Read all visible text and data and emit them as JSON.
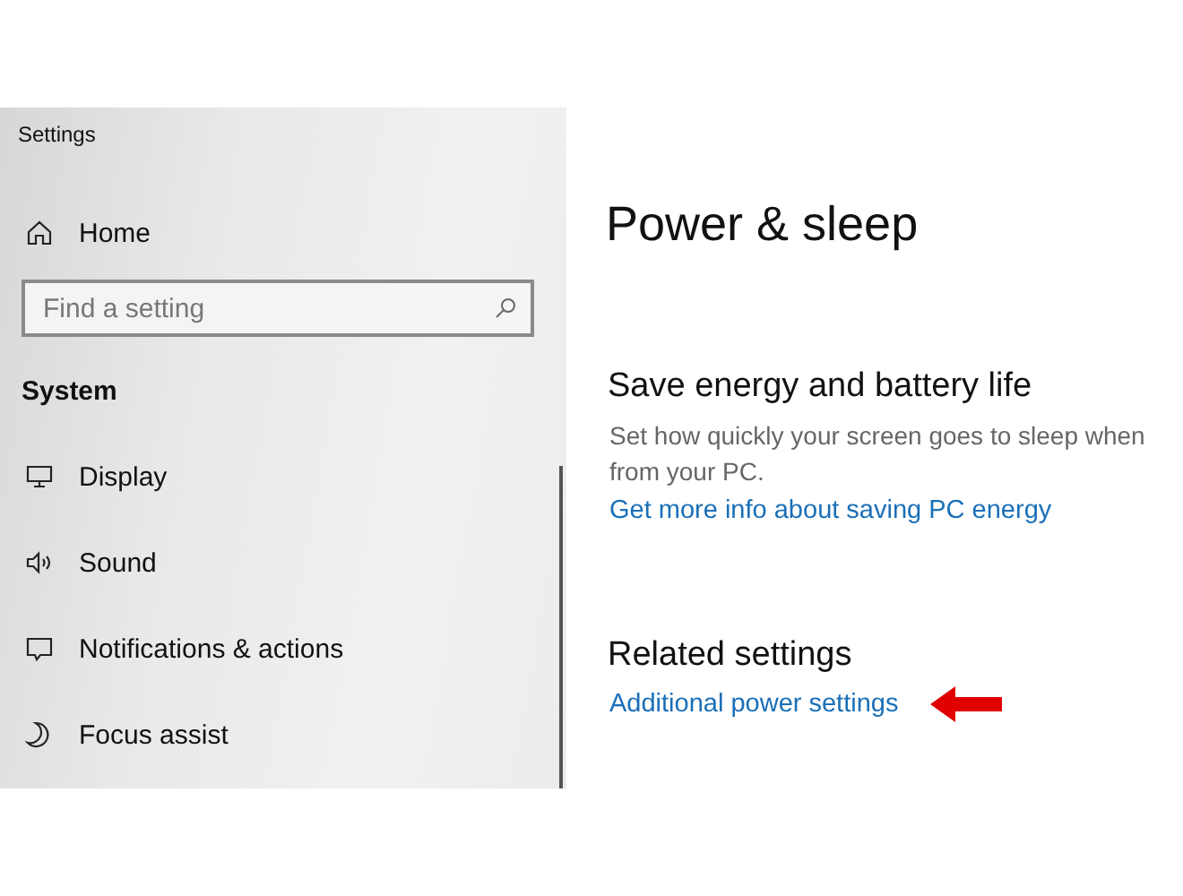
{
  "window": {
    "title": "Settings"
  },
  "sidebar": {
    "home": "Home",
    "search": {
      "placeholder": "Find a setting"
    },
    "section": "System",
    "items": [
      {
        "label": "Display"
      },
      {
        "label": "Sound"
      },
      {
        "label": "Notifications & actions"
      },
      {
        "label": "Focus assist"
      }
    ]
  },
  "page": {
    "title": "Power & sleep",
    "sections": [
      {
        "heading": "Save energy and battery life",
        "description": "Set how quickly your screen goes to sleep when\nfrom your PC.",
        "link": "Get more info about saving PC energy"
      },
      {
        "heading": "Related settings",
        "link": "Additional power settings",
        "pointer": true
      }
    ]
  }
}
